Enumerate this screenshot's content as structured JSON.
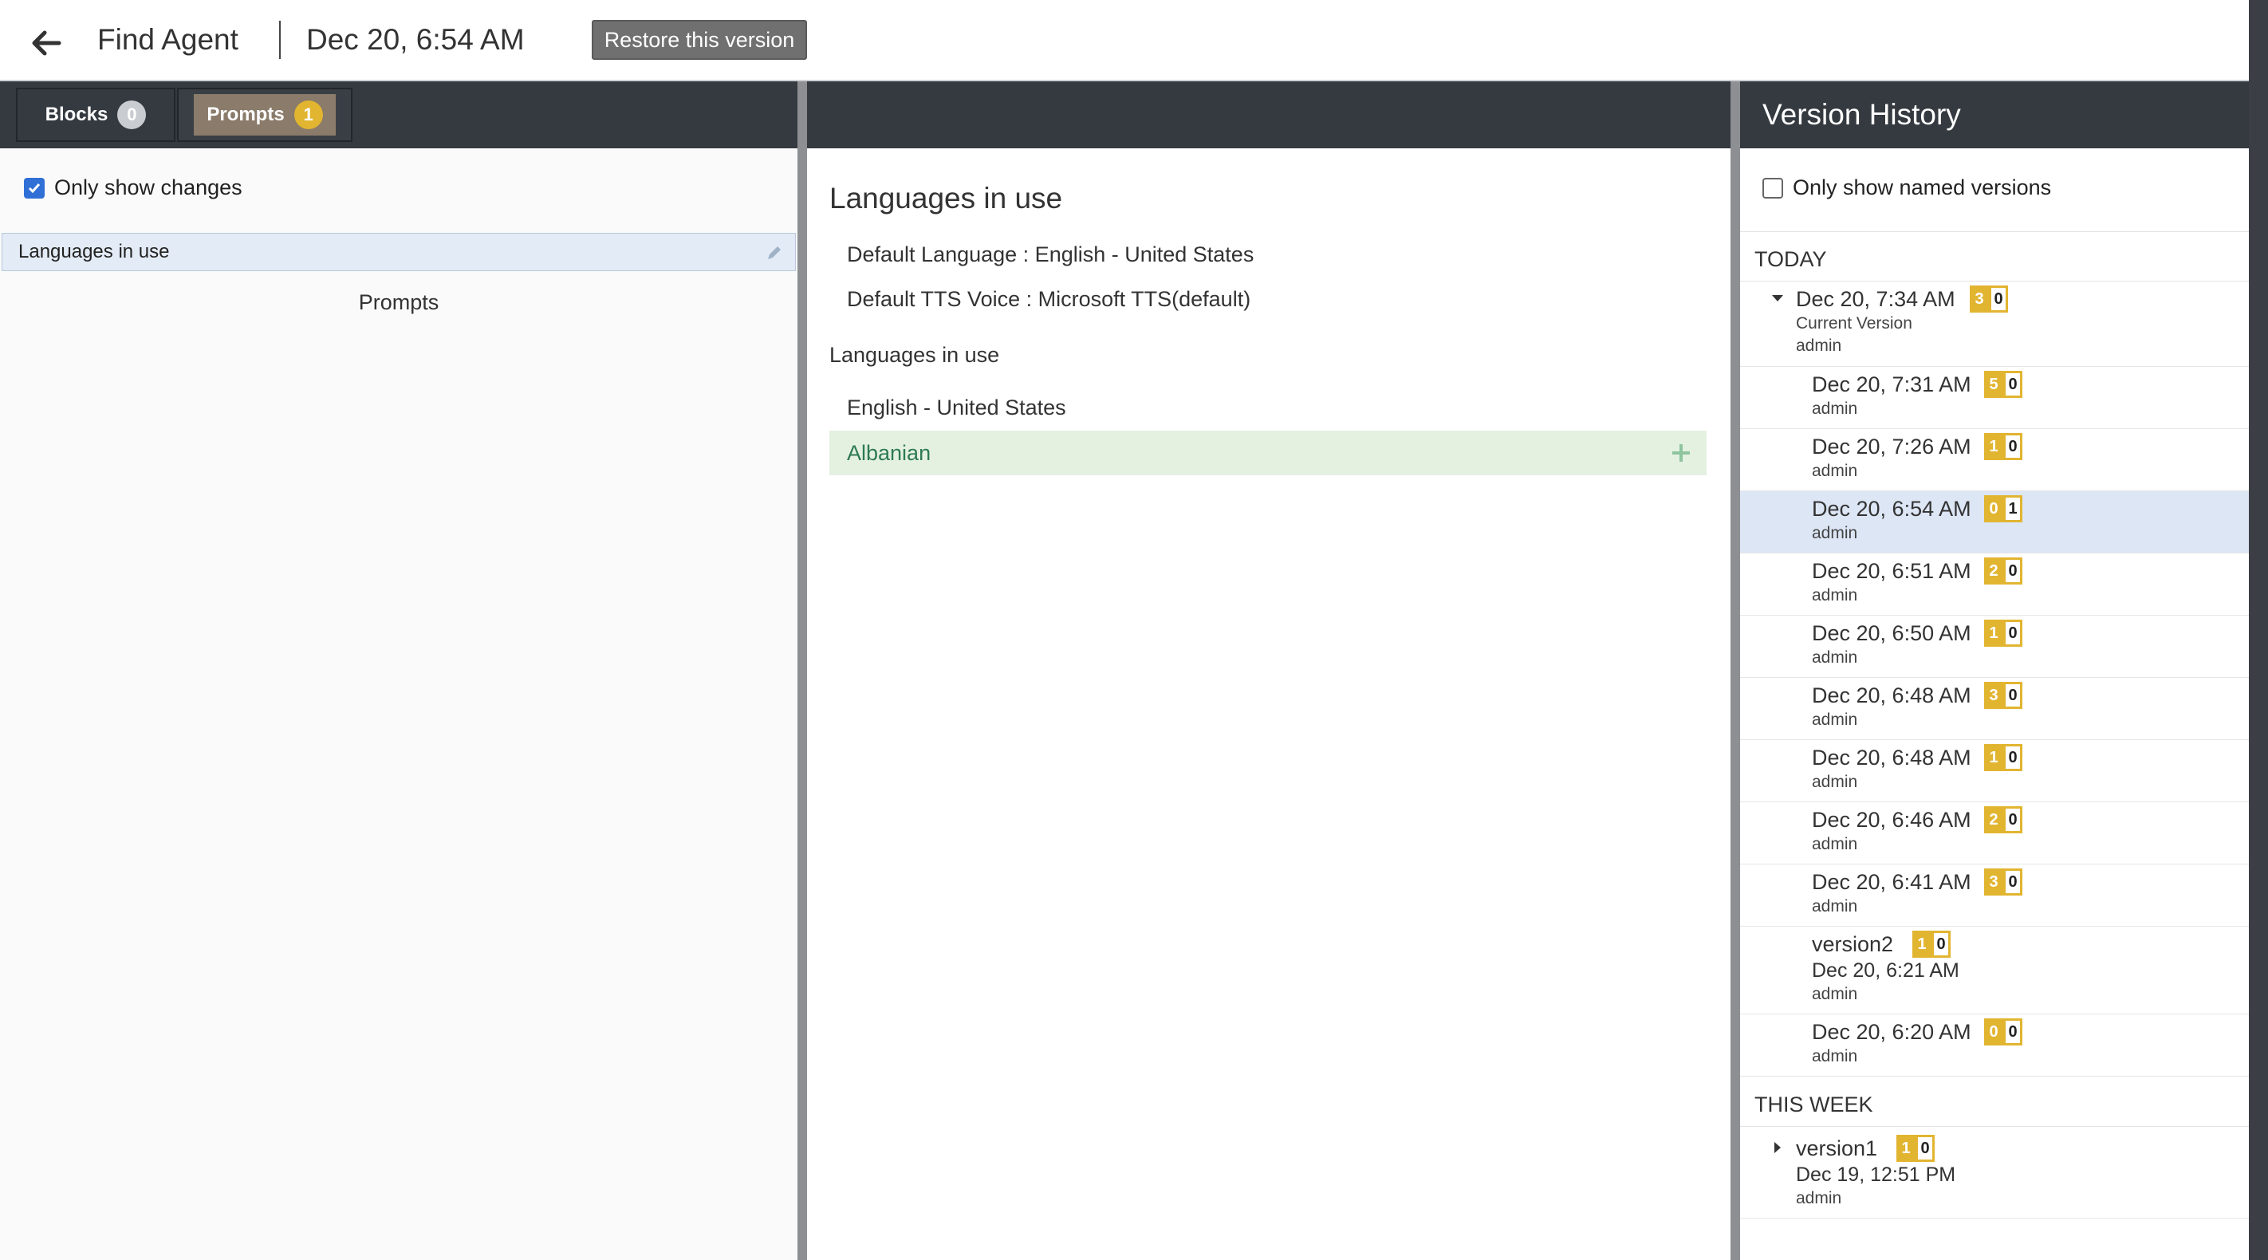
{
  "header": {
    "title": "Find Agent",
    "version_date": "Dec 20, 6:54 AM",
    "restore_label": "Restore this version"
  },
  "left": {
    "tabs": [
      {
        "label": "Blocks",
        "count": "0"
      },
      {
        "label": "Prompts",
        "count": "1"
      }
    ],
    "only_changes_label": "Only show changes",
    "selected_item": "Languages in use",
    "section_label": "Prompts"
  },
  "center": {
    "heading": "Languages in use",
    "default_language": "Default Language : English - United States",
    "default_tts": "Default TTS Voice : Microsoft TTS(default)",
    "sub_heading": "Languages in use",
    "languages": [
      "English - United States",
      "Albanian"
    ]
  },
  "version_history": {
    "title": "Version History",
    "named_only_label": "Only show named versions",
    "today_label": "TODAY",
    "this_week_label": "THIS WEEK",
    "today": [
      {
        "title": "Dec 20, 7:34 AM",
        "sub1": "Current Version",
        "sub2": "admin",
        "add": "3",
        "del": "0"
      },
      {
        "title": "Dec 20, 7:31 AM",
        "sub2": "admin",
        "add": "5",
        "del": "0"
      },
      {
        "title": "Dec 20, 7:26 AM",
        "sub2": "admin",
        "add": "1",
        "del": "0"
      },
      {
        "title": "Dec 20, 6:54 AM",
        "sub2": "admin",
        "add": "0",
        "del": "1"
      },
      {
        "title": "Dec 20, 6:51 AM",
        "sub2": "admin",
        "add": "2",
        "del": "0"
      },
      {
        "title": "Dec 20, 6:50 AM",
        "sub2": "admin",
        "add": "1",
        "del": "0"
      },
      {
        "title": "Dec 20, 6:48 AM",
        "sub2": "admin",
        "add": "3",
        "del": "0"
      },
      {
        "title": "Dec 20, 6:48 AM",
        "sub2": "admin",
        "add": "1",
        "del": "0"
      },
      {
        "title": "Dec 20, 6:46 AM",
        "sub2": "admin",
        "add": "2",
        "del": "0"
      },
      {
        "title": "Dec 20, 6:41 AM",
        "sub2": "admin",
        "add": "3",
        "del": "0"
      },
      {
        "title": "version2",
        "sub1": "Dec 20, 6:21 AM",
        "sub2": "admin",
        "add": "1",
        "del": "0"
      },
      {
        "title": "Dec 20, 6:20 AM",
        "sub2": "admin",
        "add": "0",
        "del": "0"
      }
    ],
    "this_week": [
      {
        "title": "version1",
        "sub1": "Dec 19, 12:51 PM",
        "sub2": "admin",
        "add": "1",
        "del": "0"
      }
    ]
  },
  "icons": {
    "back": "arrow-left-icon",
    "pencil": "pencil-icon",
    "plus": "plus-icon",
    "caret_down": "caret-down-icon",
    "caret_right": "caret-right-icon"
  },
  "colors": {
    "dark_bar": "#343a40",
    "badge": "#e2b531",
    "selected_row": "#dde6f5",
    "added_row": "#e4f1e1",
    "added_text": "#2d7a55",
    "checkbox": "#2f6fd6"
  }
}
